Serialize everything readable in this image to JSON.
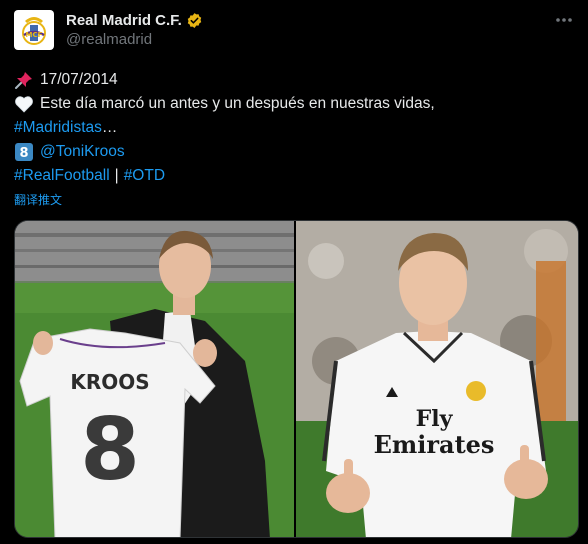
{
  "account": {
    "display_name": "Real Madrid C.F.",
    "handle": "@realmadrid",
    "verified_color": "#e8b514"
  },
  "tweet": {
    "date_icon": "pushpin-icon",
    "date": "17/07/2014",
    "heart_icon": "white-heart-icon",
    "line1": "Este día marcó un antes y un después en nuestras vidas,",
    "hashtag1": "#Madridistas",
    "ellipsis": "…",
    "number_icon": "keycap-8-icon",
    "number_keycap": "8",
    "mention": "@ToniKroos",
    "hashtag2": "#RealFootball",
    "separator": "|",
    "hashtag3": "#OTD"
  },
  "translate_label": "翻译推文",
  "media": {
    "left_jersey_name": "KROOS",
    "left_jersey_number": "8",
    "right_shirt_sponsor_line1": "Fly",
    "right_shirt_sponsor_line2": "Emirates"
  },
  "colors": {
    "background": "#000000",
    "text": "#e7e9ea",
    "secondary": "#71767b",
    "link": "#1d9bf0"
  }
}
